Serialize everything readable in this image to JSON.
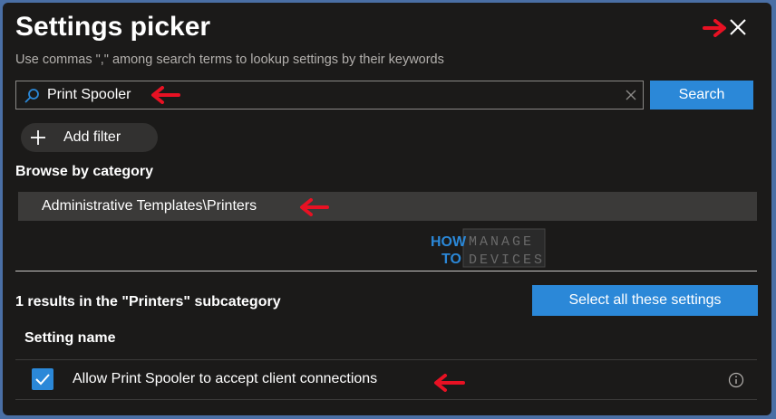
{
  "panel": {
    "title": "Settings picker",
    "subtitle": "Use commas \",\" among search terms to lookup settings by their keywords"
  },
  "search": {
    "value": "Print Spooler",
    "button_label": "Search"
  },
  "filter": {
    "add_label": "Add filter"
  },
  "browse": {
    "heading": "Browse by category",
    "selected_category": "Administrative Templates\\Printers"
  },
  "watermark": {
    "line1_left": "HOW",
    "line1_right": "MANAGE",
    "line2_left": "TO",
    "line2_right": "DEVICES"
  },
  "results": {
    "summary": "1 results in the \"Printers\" subcategory",
    "select_all_label": "Select all these settings",
    "column_header": "Setting name",
    "rows": [
      {
        "name": "Allow Print Spooler to accept client connections",
        "checked": true
      }
    ]
  },
  "colors": {
    "accent": "#2b88d8",
    "panel_bg": "#1b1a19",
    "annotation_arrow": "#e81123"
  },
  "icons": {
    "close": "close-icon",
    "search": "search-icon",
    "clear": "clear-icon",
    "add": "plus-icon",
    "check": "checkmark-icon",
    "info": "info-icon",
    "annotation": "red-arrow-icon"
  }
}
